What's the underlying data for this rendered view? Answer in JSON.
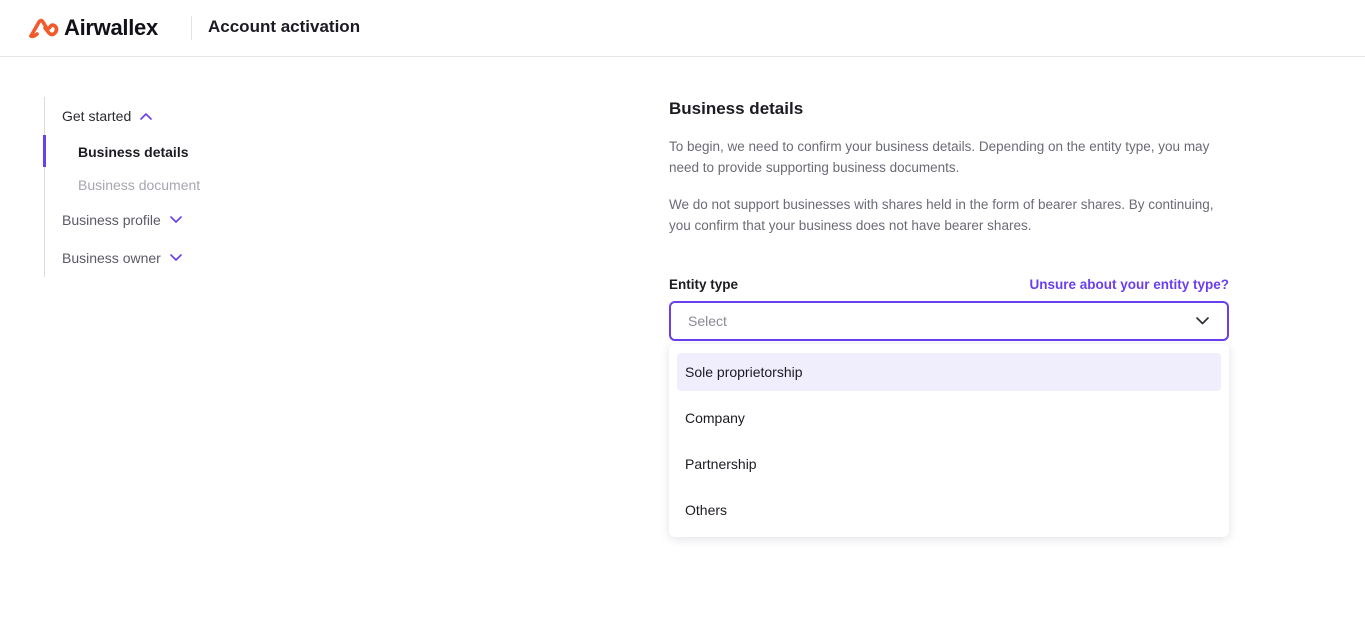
{
  "header": {
    "brand": "Airwallex",
    "title": "Account activation"
  },
  "sidebar": {
    "sections": [
      {
        "label": "Get started",
        "expanded": true,
        "items": [
          {
            "label": "Business details",
            "active": true
          },
          {
            "label": "Business document",
            "active": false
          }
        ]
      },
      {
        "label": "Business profile",
        "expanded": false
      },
      {
        "label": "Business owner",
        "expanded": false
      }
    ]
  },
  "main": {
    "title": "Business details",
    "paragraph1": "To begin, we need to confirm your business details. Depending on the entity type, you may need to provide supporting business documents.",
    "paragraph2": "We do not support businesses with shares held in the form of bearer shares. By continuing, you confirm that your business does not have bearer shares.",
    "entity_label": "Entity type",
    "help_link": "Unsure about your entity type?",
    "select_placeholder": "Select",
    "options": [
      "Sole proprietorship",
      "Company",
      "Partnership",
      "Others"
    ]
  },
  "colors": {
    "accent": "#6a3ff0",
    "brand_orange": "#f2592b",
    "option_highlight": "#f0eefc"
  }
}
